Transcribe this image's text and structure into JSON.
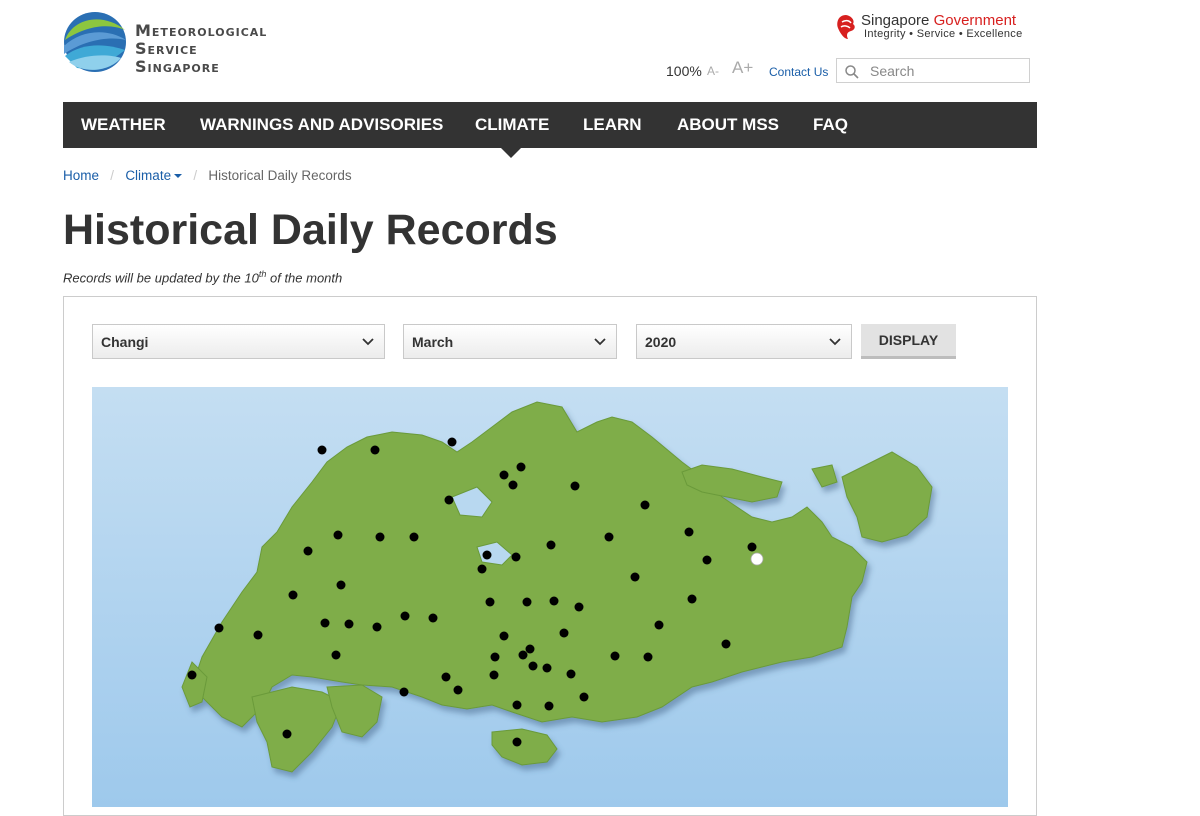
{
  "header": {
    "logo_lines": [
      "Meteorological",
      "Service",
      "Singapore"
    ],
    "gov_name_1": "Singapore",
    "gov_name_2": "Government",
    "gov_tagline": "Integrity • Service • Excellence",
    "zoom_level": "100%",
    "font_decrease": "A-",
    "font_increase": "A+",
    "contact_label": "Contact Us",
    "search_placeholder": "Search"
  },
  "nav": {
    "items": [
      "WEATHER",
      "WARNINGS AND ADVISORIES",
      "CLIMATE",
      "LEARN",
      "ABOUT MSS",
      "FAQ"
    ],
    "active": "CLIMATE"
  },
  "breadcrumb": {
    "home": "Home",
    "section": "Climate",
    "current": "Historical Daily Records"
  },
  "page": {
    "title": "Historical Daily Records",
    "note_prefix": "Records will be updated by the 10",
    "note_sup": "th",
    "note_suffix": " of the month"
  },
  "form": {
    "station": "Changi",
    "month": "March",
    "year": "2020",
    "display_label": "DISPLAY"
  },
  "map": {
    "sea_color": "#b8d8f0",
    "land_color": "#7fad48",
    "station_color": "#000000",
    "selected_station_color": "#ffffff",
    "selected_station": "Changi"
  },
  "colors": {
    "nav_bg": "#333333",
    "link": "#1a5ea8",
    "gov_red": "#d7201f"
  }
}
